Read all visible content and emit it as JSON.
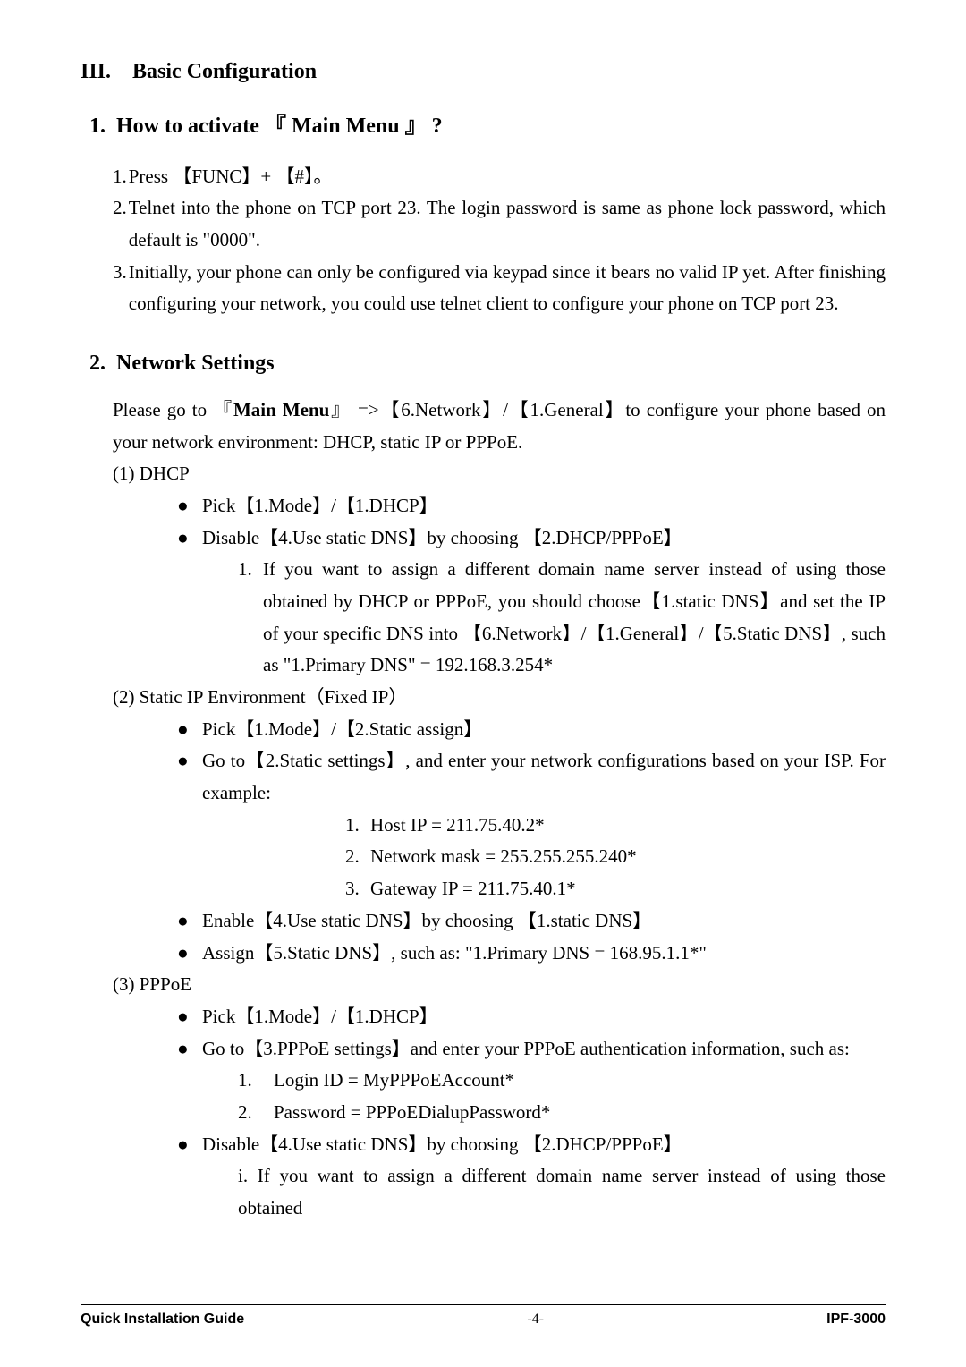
{
  "section": {
    "number": "III.",
    "title": "Basic Configuration"
  },
  "sub1": {
    "number": "1.",
    "title_prefix": "How to activate ",
    "title_quote_open": "『",
    "title_bold": "Main Menu",
    "title_quote_close": "』",
    "title_suffix": "?"
  },
  "activate": {
    "l1_num": "1.",
    "l1_a": "Press ",
    "l1_b": "【FUNC】+ 【#】。",
    "l2_num": "2.",
    "l2": "Telnet into the phone on TCP port 23. The login password is same as phone lock password, which default is \"0000\".",
    "l3_num": "3.",
    "l3": "Initially, your phone can only be configured via keypad since it bears no valid IP yet. After finishing configuring your network, you could use telnet client to configure your phone on TCP port 23."
  },
  "sub2": {
    "number": "2.",
    "title": "Network Settings"
  },
  "network": {
    "intro_a": "Please go to 『",
    "intro_bold": "Main Menu",
    "intro_b": "』 =>【6.Network】/【1.General】to configure your phone based on your network environment: DHCP, static IP or PPPoE.",
    "dhcp_head": "(1)  DHCP",
    "dhcp_b1": "Pick【1.Mode】/【1.DHCP】",
    "dhcp_b2": "Disable【4.Use static DNS】by choosing  【2.DHCP/PPPoE】",
    "dhcp_n1_num": "1.",
    "dhcp_n1": "If you want to assign a different domain name server instead of using those obtained by DHCP or PPPoE, you should choose【1.static DNS】and set the IP of your specific DNS into 【6.Network】/【1.General】/【5.Static DNS】, such as \"1.Primary DNS\" = 192.168.3.254*",
    "static_head": "(2)  Static IP Environment（Fixed IP）",
    "static_b1": "Pick【1.Mode】/【2.Static assign】",
    "static_b2": "Go to【2.Static settings】, and enter your network configurations based on your ISP. For example:",
    "static_e1_num": "1.",
    "static_e1": "Host IP = 211.75.40.2*",
    "static_e2_num": "2.",
    "static_e2": "Network mask = 255.255.255.240*",
    "static_e3_num": "3.",
    "static_e3": "Gateway IP = 211.75.40.1*",
    "static_b3": "Enable【4.Use static DNS】by choosing  【1.static DNS】",
    "static_b4": "Assign【5.Static DNS】, such as: \"1.Primary DNS = 168.95.1.1*\"",
    "pppoe_head": "(3)  PPPoE",
    "pppoe_b1": "Pick【1.Mode】/【1.DHCP】",
    "pppoe_b2": "Go to【3.PPPoE settings】and enter your PPPoE authentication information, such as:",
    "pppoe_n1_num": "1.",
    "pppoe_n1": "Login ID = MyPPPoEAccount*",
    "pppoe_n2_num": "2.",
    "pppoe_n2": "Password = PPPoEDialupPassword*",
    "pppoe_b3": "Disable【4.Use static DNS】by choosing  【2.DHCP/PPPoE】",
    "pppoe_i": "i. If you want to assign a different domain name server instead of using those obtained"
  },
  "footer": {
    "left": "Quick Installation Guide",
    "mid": "-4-",
    "right": "IPF-3000"
  },
  "glyphs": {
    "bullet": "●"
  }
}
